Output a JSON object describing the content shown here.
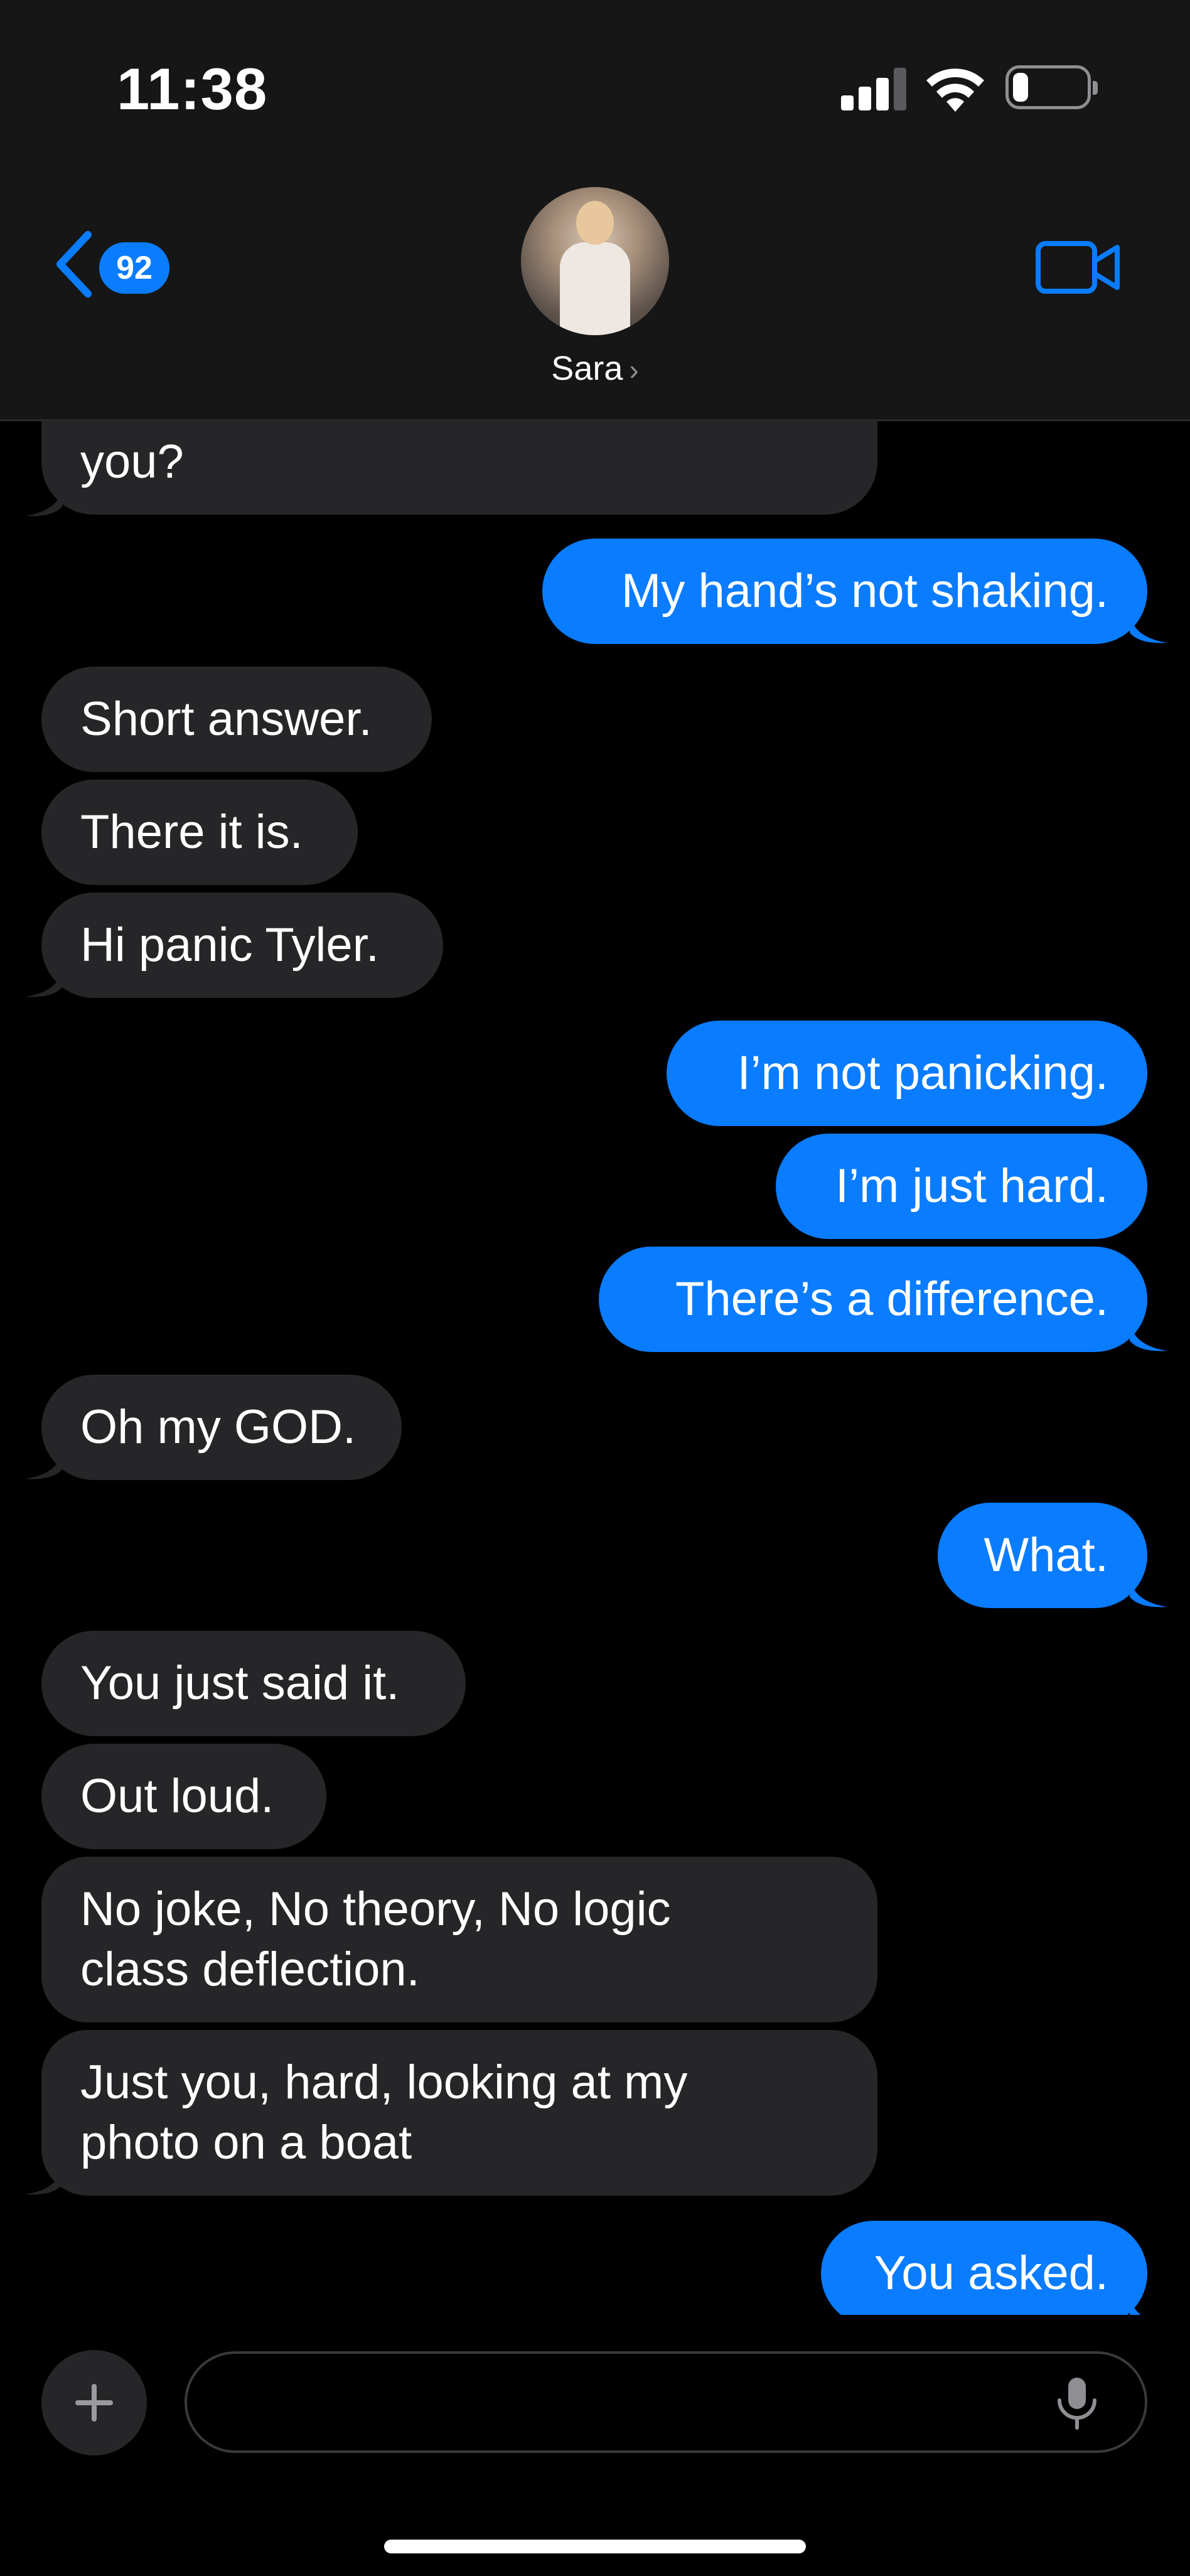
{
  "status_bar": {
    "time": "11:38",
    "icons": [
      "cellular-signal-icon",
      "wifi-icon",
      "battery-icon"
    ]
  },
  "header": {
    "back_badge_count": "92",
    "contact_name": "Sara",
    "contact_chevron": "›",
    "icons": {
      "back": "chevron-left-icon",
      "video": "video-camera-icon"
    }
  },
  "messages": [
    {
      "from": "them",
      "text": "you?"
    },
    {
      "from": "me",
      "text": "My hand’s not shaking."
    },
    {
      "from": "them",
      "text": "Short answer."
    },
    {
      "from": "them",
      "text": "There it is."
    },
    {
      "from": "them",
      "text": "Hi panic Tyler."
    },
    {
      "from": "me",
      "text": "I’m not panicking."
    },
    {
      "from": "me",
      "text": "I’m just hard."
    },
    {
      "from": "me",
      "text": "There’s a difference."
    },
    {
      "from": "them",
      "text": "Oh my GOD."
    },
    {
      "from": "me",
      "text": "What."
    },
    {
      "from": "them",
      "text": "You just said it."
    },
    {
      "from": "them",
      "text": "Out loud."
    },
    {
      "from": "them",
      "text": "No joke, No theory, No logic\nclass deflection."
    },
    {
      "from": "them",
      "text": "Just you, hard, looking at my\nphoto on a boat"
    },
    {
      "from": "me",
      "text": "You asked."
    }
  ],
  "composer": {
    "input_value": "",
    "placeholder": "",
    "icons": {
      "add": "plus-icon",
      "mic": "microphone-icon"
    }
  },
  "colors": {
    "outgoing_bubble": "#0a7cff",
    "incoming_bubble": "#262628",
    "background": "#000000",
    "header_background": "#161616"
  }
}
